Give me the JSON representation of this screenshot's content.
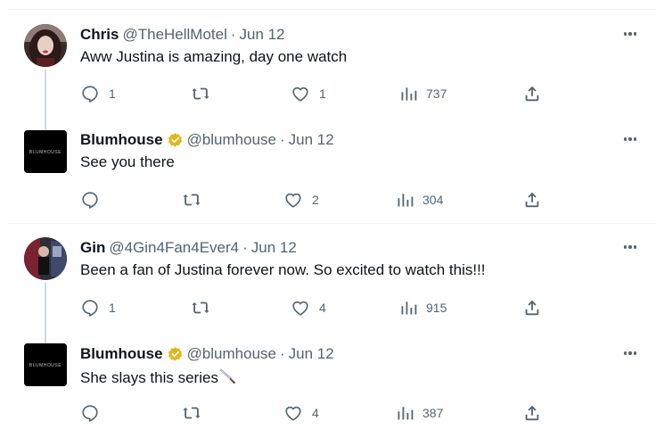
{
  "tweets": [
    {
      "name": "Chris",
      "handle": "@TheHellMotel",
      "separator": "·",
      "date": "Jun 12",
      "text": "Aww Justina is amazing, day one watch",
      "replies": "1",
      "retweets": "",
      "likes": "1",
      "views": "737",
      "verified": false
    },
    {
      "name": "Blumhouse",
      "handle": "@blumhouse",
      "separator": "·",
      "date": "Jun 12",
      "text": "See you there",
      "replies": "",
      "retweets": "",
      "likes": "2",
      "views": "304",
      "verified": true,
      "avatar_logo": "BLUMHOUSE"
    },
    {
      "name": "Gin",
      "handle": "@4Gin4Fan4Ever4",
      "separator": "·",
      "date": "Jun 12",
      "text": "Been a fan of Justina forever now. So excited to watch this!!!",
      "replies": "1",
      "retweets": "",
      "likes": "4",
      "views": "915",
      "verified": false
    },
    {
      "name": "Blumhouse",
      "handle": "@blumhouse",
      "separator": "·",
      "date": "Jun 12",
      "text": "She slays this series",
      "emoji": "knife-emoji",
      "replies": "",
      "retweets": "",
      "likes": "4",
      "views": "387",
      "verified": true,
      "avatar_logo": "BLUMHOUSE"
    }
  ],
  "icons": {
    "reply": "reply-icon",
    "retweet": "retweet-icon",
    "like": "like-icon",
    "views": "views-icon",
    "share": "share-icon",
    "more": "more-icon",
    "verified": "verified-badge-icon"
  },
  "colors": {
    "text": "#0f1419",
    "secondary": "#536471",
    "divider": "#eff3f4",
    "thread_line": "#cfd9de",
    "verified_gold": "#e2b719"
  }
}
